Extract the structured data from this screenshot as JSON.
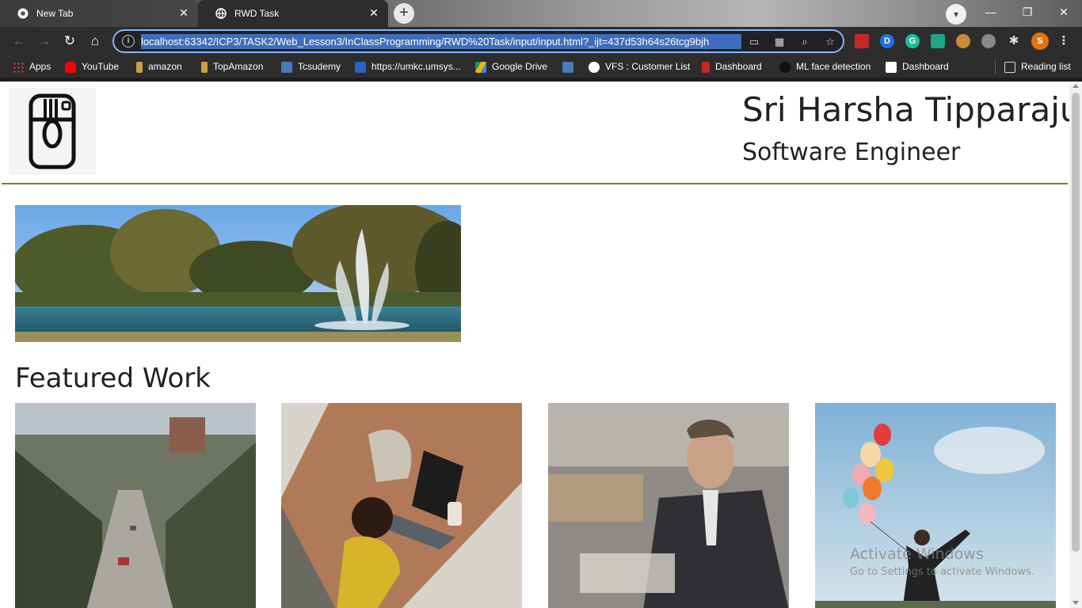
{
  "browser": {
    "tabs": [
      {
        "title": "New Tab",
        "active": false
      },
      {
        "title": "RWD Task",
        "active": true
      }
    ],
    "url": "localhost:63342/ICP3/TASK2/Web_Lesson3/InClassProgramming/RWD%20Task/input/input.html?_ijt=437d53h64s26tcg9bjh",
    "profile_initial": "S",
    "extensions": [
      "D",
      "G"
    ],
    "bookmarks": [
      {
        "label": "Apps",
        "icon": "apps-grid-icon"
      },
      {
        "label": "YouTube",
        "icon": "youtube-icon"
      },
      {
        "label": "amazon",
        "icon": "amazon-icon"
      },
      {
        "label": "TopAmazon",
        "icon": "amazon-icon"
      },
      {
        "label": "Tcsudemy",
        "icon": "tata-icon"
      },
      {
        "label": "https://umkc.umsys...",
        "icon": "umkc-icon"
      },
      {
        "label": "Google Drive",
        "icon": "google-drive-icon"
      },
      {
        "label": "",
        "icon": "tata-icon"
      },
      {
        "label": "VFS : Customer List",
        "icon": "globe-icon"
      },
      {
        "label": "Dashboard",
        "icon": "dashboard-icon"
      },
      {
        "label": "ML face detection",
        "icon": "github-icon"
      },
      {
        "label": "Dashboard",
        "icon": "dashboard-icon"
      }
    ],
    "reading_list": "Reading list"
  },
  "page": {
    "name": "Sri Harsha Tipparaju",
    "role": "Software Engineer",
    "featured_heading": "Featured Work",
    "logo_icon": "instagram-camera-icon",
    "hero_image": "fountain-lake-park",
    "works": [
      "street-hill-photo",
      "laptop-desk-photo",
      "businessman-cafe-photo",
      "balloons-sky-photo"
    ]
  },
  "watermark": {
    "title": "Activate Windows",
    "subtitle": "Go to Settings to activate Windows."
  },
  "colors": {
    "chrome_dark": "#2d2d2d",
    "omnibox_focus": "#8ab4f8",
    "url_selection": "#3e6dbd",
    "header_rule": "#8a7a2a",
    "text": "#222222"
  }
}
